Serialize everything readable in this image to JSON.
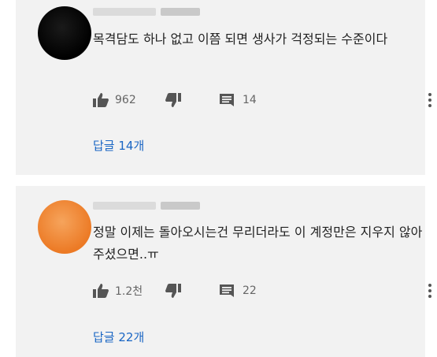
{
  "comments": [
    {
      "author": "",
      "text": "목격담도 하나 없고 이쯤 되면 생사가 걱정되는 수준이다",
      "likes": "962",
      "replies_count": "14",
      "reply_link": "답글 14개"
    },
    {
      "author": "",
      "text": "정말 이제는 돌아오시는건 무리더라도 이 계정만은 지우지 않아주셨으면..ㅠ",
      "likes": "1.2천",
      "replies_count": "22",
      "reply_link": "답글 22개"
    }
  ],
  "colors": {
    "card_bg": "#f2f2f2",
    "link": "#1a66c4",
    "icon": "#555555",
    "avatar_1": "#000000",
    "avatar_2": "#ec7a25"
  },
  "icons": [
    "thumbs-up-icon",
    "thumbs-down-icon",
    "comment-icon",
    "more-vert-icon"
  ]
}
